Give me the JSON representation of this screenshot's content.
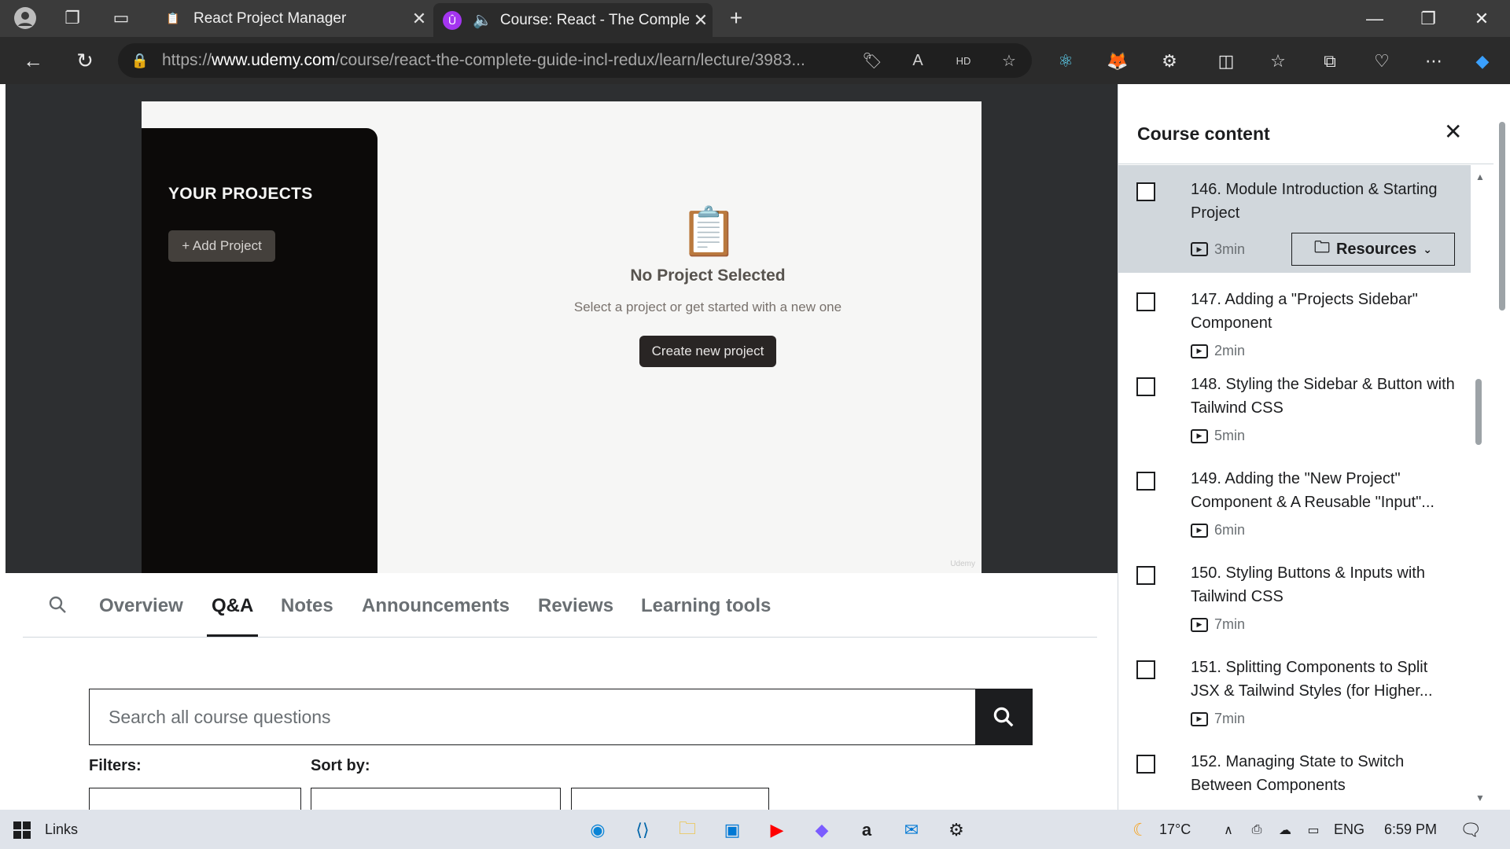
{
  "browser": {
    "tabs": [
      {
        "title": "React Project Manager",
        "active": false
      },
      {
        "title": "Course: React - The Comple",
        "active": true
      }
    ],
    "url_prefix": "https://",
    "url_domain": "www.udemy.com",
    "url_path": "/course/react-the-complete-guide-incl-redux/learn/lecture/3983..."
  },
  "video": {
    "sidebar_heading": "YOUR PROJECTS",
    "add_project_label": "+ Add Project",
    "empty_title": "No Project Selected",
    "empty_subtitle": "Select a project or get started with a new one",
    "create_button": "Create new project",
    "watermark": "Udemy"
  },
  "course_tabs": [
    "Overview",
    "Q&A",
    "Notes",
    "Announcements",
    "Reviews",
    "Learning tools"
  ],
  "active_tab": "Q&A",
  "qa": {
    "search_placeholder": "Search all course questions",
    "filters_label": "Filters:",
    "sort_label": "Sort by:"
  },
  "course_content": {
    "title": "Course content",
    "resources_label": "Resources",
    "lectures": [
      {
        "title": "146. Module Introduction & Starting Project",
        "duration": "3min",
        "active": true
      },
      {
        "title": "147. Adding a \"Projects Sidebar\" Component",
        "duration": "2min",
        "active": false
      },
      {
        "title": "148. Styling the Sidebar & Button with Tailwind CSS",
        "duration": "5min",
        "active": false
      },
      {
        "title": "149. Adding the \"New Project\" Component & A Reusable \"Input\"...",
        "duration": "6min",
        "active": false
      },
      {
        "title": "150. Styling Buttons & Inputs with Tailwind CSS",
        "duration": "7min",
        "active": false
      },
      {
        "title": "151. Splitting Components to Split JSX & Tailwind Styles (for Higher...",
        "duration": "7min",
        "active": false
      },
      {
        "title": "152. Managing State to Switch Between Components",
        "duration": "",
        "active": false
      }
    ]
  },
  "taskbar": {
    "search_text": "Links",
    "weather": "17°C",
    "language": "ENG",
    "time": "6:59 PM"
  },
  "colors": {
    "accent_dark": "#1c1d1f",
    "video_bg": "#2d2f31",
    "sidebar_active": "#d1d7dc"
  }
}
